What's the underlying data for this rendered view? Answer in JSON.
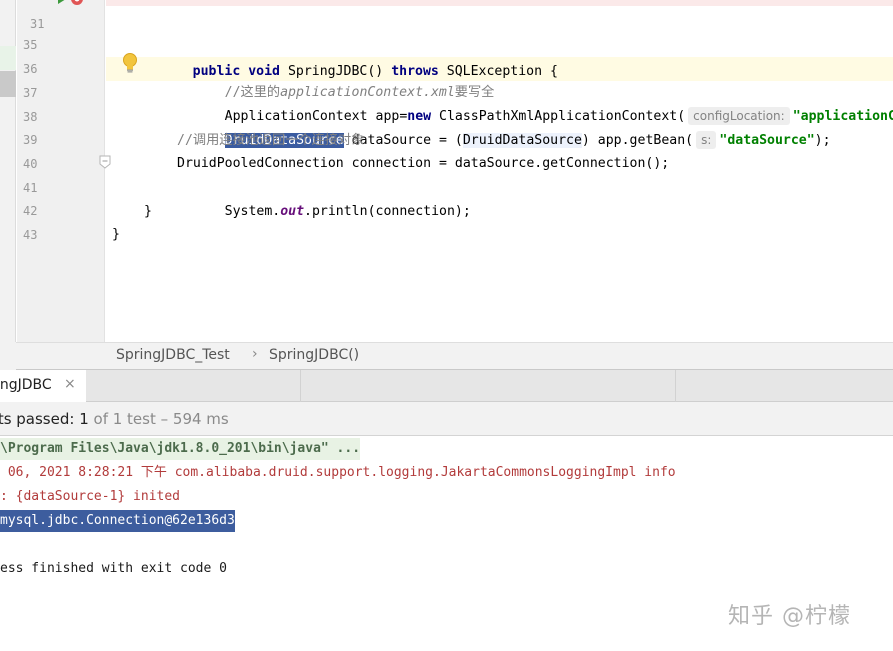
{
  "editor": {
    "lines": [
      {
        "num": "31",
        "kind": "top"
      },
      {
        "num": "35",
        "kind": "comment"
      },
      {
        "num": "36",
        "kind": "ctx"
      },
      {
        "num": "37",
        "kind": "ds"
      },
      {
        "num": "38",
        "kind": "comment2"
      },
      {
        "num": "39",
        "kind": "conn"
      },
      {
        "num": "40",
        "kind": "println"
      },
      {
        "num": "41",
        "kind": "brace1"
      },
      {
        "num": "42",
        "kind": "brace2"
      },
      {
        "num": "43",
        "kind": "empty"
      }
    ],
    "line31": {
      "kw1": "public",
      "kw2": "void",
      "name": "SpringJDBC()",
      "kw3": "throws",
      "exc": "SQLException {"
    },
    "line35": {
      "prefix": "//这里的",
      "italic": "applicationContext.xml",
      "suffix": "要写全"
    },
    "line36": {
      "type": "ApplicationContext",
      "var": " app=",
      "kw": "new",
      "cls": " ClassPathXmlApplicationContext(",
      "hint": "configLocation:",
      "str": "\"applicationCon"
    },
    "line37": {
      "sel": "DruidDataSource",
      "mid": " dataSource = (",
      "cast": "DruidDataSource",
      "after": ") app.getBean(",
      "hint": "s:",
      "str": "\"dataSource\"",
      "end": ");"
    },
    "line38": {
      "text": "//调用连接池返回一个连接对象"
    },
    "line39": {
      "text": "DruidPooledConnection connection = dataSource.getConnection();"
    },
    "line40": {
      "pre": "System.",
      "field": "out",
      "post": ".println(connection);"
    },
    "line41": {
      "text": "}"
    },
    "line42": {
      "text": "}"
    }
  },
  "breadcrumb": {
    "items": [
      "SpringJDBC_Test",
      "SpringJDBC()"
    ],
    "separator": "›"
  },
  "run": {
    "tab_label": "ingJDBC",
    "tab_close": "×",
    "status_label": "sts passed: ",
    "status_count": "1",
    "status_rest": " of 1 test – 594 ms"
  },
  "console": {
    "lines": [
      "\\Program Files\\Java\\jdk1.8.0_201\\bin\\java\" ...",
      " 06, 2021 8:28:21 下午 com.alibaba.druid.support.logging.JakartaCommonsLoggingImpl info",
      ": {dataSource-1} inited",
      "mysql.jdbc.Connection@62e136d3",
      "ess finished with exit code 0"
    ]
  },
  "watermark": "知乎 @柠檬",
  "icons": {
    "bulb": "lightbulb-icon",
    "run": "run-gutter-icon",
    "fold": "fold-icon",
    "close": "close-icon"
  }
}
